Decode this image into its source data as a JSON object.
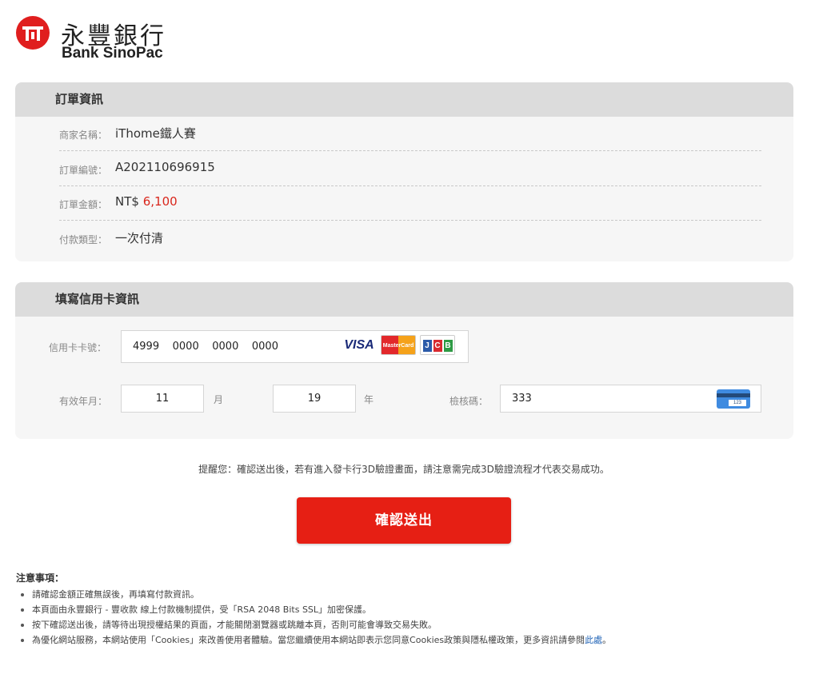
{
  "logo": {
    "name_cn": "永豐銀行",
    "name_en": "Bank SinoPac"
  },
  "order": {
    "title": "訂單資訊",
    "rows": [
      {
        "label": "商家名稱：",
        "value": "iThome鐵人賽"
      },
      {
        "label": "訂單編號：",
        "value": "A202110696915"
      },
      {
        "label": "訂單金額：",
        "currency": "NT$",
        "value": "6,100"
      },
      {
        "label": "付款類型：",
        "value": "一次付清"
      }
    ]
  },
  "card": {
    "title": "填寫信用卡資訊",
    "number_label": "信用卡卡號：",
    "number": [
      "4999",
      "0000",
      "0000",
      "0000"
    ],
    "logos": {
      "visa": "VISA",
      "mastercard": "MasterCard",
      "jcb": [
        "J",
        "C",
        "B"
      ]
    },
    "expiry_label": "有效年月：",
    "month": "11",
    "month_unit": "月",
    "year": "19",
    "year_unit": "年",
    "cvv_label": "檢核碼：",
    "cvv": "333",
    "cvv_icon_text": "123"
  },
  "reminder": "提醒您：確認送出後，若有進入發卡行3D驗證畫面，請注意需完成3D驗證流程才代表交易成功。",
  "submit_label": "確認送出",
  "notes": {
    "title": "注意事項：",
    "items": [
      "請確認金額正確無誤後，再填寫付款資訊。",
      "本頁面由永豐銀行 - 豐收款 線上付款機制提供，受「RSA 2048 Bits SSL」加密保護。",
      "按下確認送出後，請等待出現授權結果的頁面，才能關閉瀏覽器或跳離本頁，否則可能會導致交易失敗。"
    ],
    "last_item": "為優化網站服務，本網站使用「Cookies」來改善使用者體驗。當您繼續使用本網站即表示您同意Cookies政策與隱私權政策，更多資訊請參閱",
    "last_link": "此處",
    "last_suffix": "。"
  },
  "colors": {
    "brand_red": "#e01e1e",
    "button_red": "#e61f14",
    "amount_red": "#d9261c",
    "link_blue": "#1a5fb4",
    "panel_bg": "#f6f6f6",
    "panel_header": "#dcdcdc"
  }
}
